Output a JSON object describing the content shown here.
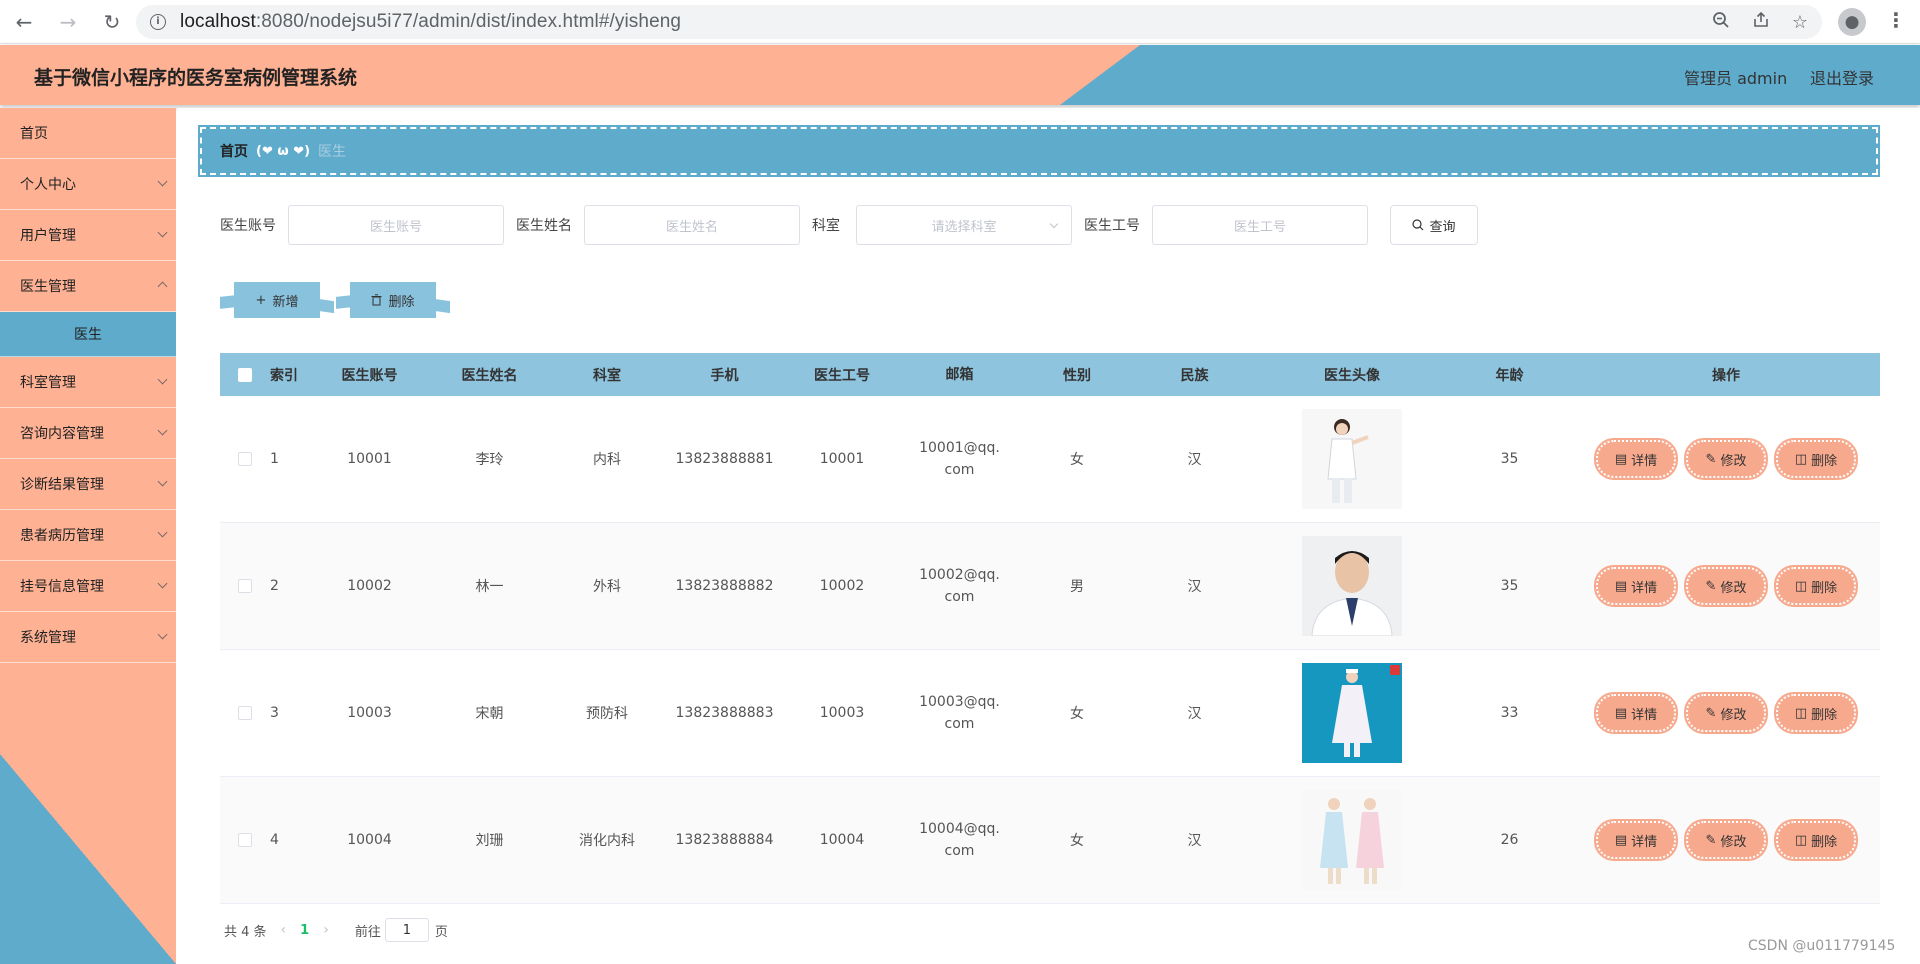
{
  "browser": {
    "url_host": "localhost",
    "url_rest": ":8080/nodejsu5i77/admin/dist/index.html#/yisheng"
  },
  "header": {
    "title": "基于微信小程序的医务室病例管理系统",
    "user": "管理员 admin",
    "logout": "退出登录"
  },
  "sidebar": {
    "items": [
      {
        "label": "首页"
      },
      {
        "label": "个人中心"
      },
      {
        "label": "用户管理"
      },
      {
        "label": "医生管理"
      },
      {
        "label": "医生"
      },
      {
        "label": "科室管理"
      },
      {
        "label": "咨询内容管理"
      },
      {
        "label": "诊断结果管理"
      },
      {
        "label": "患者病历管理"
      },
      {
        "label": "挂号信息管理"
      },
      {
        "label": "系统管理"
      }
    ]
  },
  "breadcrumb": {
    "home": "首页",
    "separator": "(❤ ω ❤)",
    "current": "医生"
  },
  "search": {
    "account_label": "医生账号",
    "account_placeholder": "医生账号",
    "name_label": "医生姓名",
    "name_placeholder": "医生姓名",
    "dept_label": "科室",
    "dept_placeholder": "请选择科室",
    "no_label": "医生工号",
    "no_placeholder": "医生工号",
    "query_button": "查询"
  },
  "actions": {
    "add": "新增",
    "delete": "删除"
  },
  "table": {
    "headers": [
      "索引",
      "医生账号",
      "医生姓名",
      "科室",
      "手机",
      "医生工号",
      "邮箱",
      "性别",
      "民族",
      "医生头像",
      "年龄",
      "操作"
    ],
    "rows": [
      {
        "idx": "1",
        "account": "10001",
        "name": "李玲",
        "dept": "内科",
        "phone": "13823888881",
        "no": "10001",
        "email": "10001@qq.com",
        "sex": "女",
        "ethnicity": "汉",
        "age": "35"
      },
      {
        "idx": "2",
        "account": "10002",
        "name": "林一",
        "dept": "外科",
        "phone": "13823888882",
        "no": "10002",
        "email": "10002@qq.com",
        "sex": "男",
        "ethnicity": "汉",
        "age": "35"
      },
      {
        "idx": "3",
        "account": "10003",
        "name": "宋朝",
        "dept": "预防科",
        "phone": "13823888883",
        "no": "10003",
        "email": "10003@qq.com",
        "sex": "女",
        "ethnicity": "汉",
        "age": "33"
      },
      {
        "idx": "4",
        "account": "10004",
        "name": "刘珊",
        "dept": "消化内科",
        "phone": "13823888884",
        "no": "10004",
        "email": "10004@qq.com",
        "sex": "女",
        "ethnicity": "汉",
        "age": "26"
      }
    ],
    "op_detail": "详情",
    "op_edit": "修改",
    "op_delete": "删除"
  },
  "pager": {
    "total": "共 4 条",
    "current_page": "1",
    "goto_prefix": "前往",
    "goto_value": "1",
    "goto_suffix": "页"
  },
  "watermark": "CSDN @u011779145",
  "colors": {
    "peach": "#ffb194",
    "blue": "#5fabcc",
    "table_header": "#8ec4de",
    "op_button": "#f7a98d"
  }
}
